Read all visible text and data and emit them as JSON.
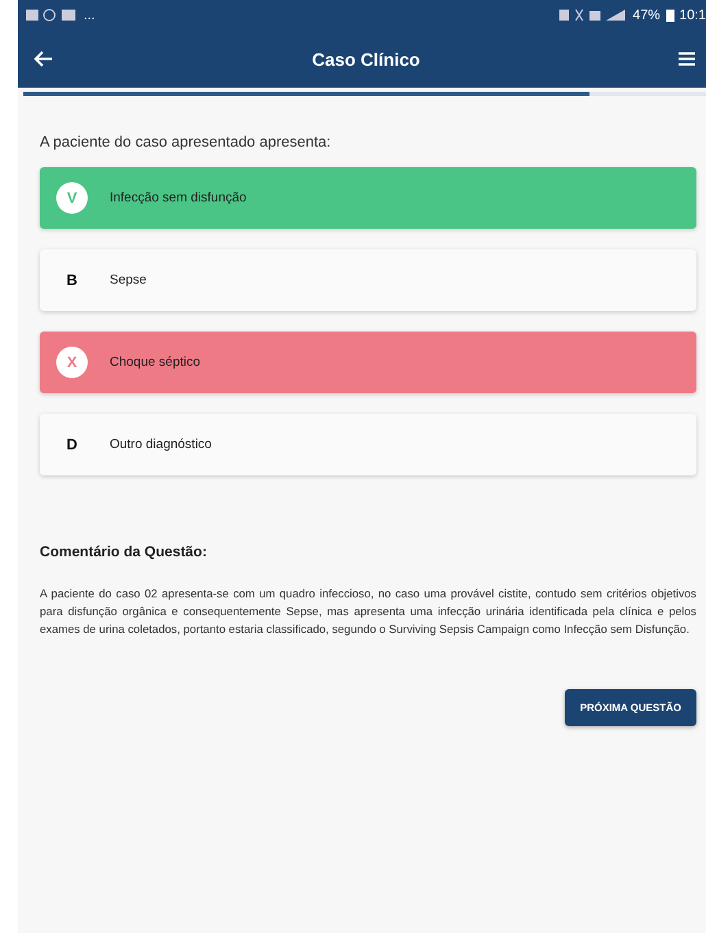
{
  "status_bar": {
    "more": "...",
    "battery": "47%",
    "time": "10:1"
  },
  "header": {
    "title": "Caso Clínico"
  },
  "progress": {
    "level": 0.83
  },
  "question": "A paciente do caso apresentado apresenta:",
  "options": [
    {
      "letter": "V",
      "text": "Infecção sem disfunção",
      "kind": "correct"
    },
    {
      "letter": "B",
      "text": "Sepse",
      "kind": "neutral"
    },
    {
      "letter": "X",
      "text": "Choque séptico",
      "kind": "wrong"
    },
    {
      "letter": "D",
      "text": "Outro diagnóstico",
      "kind": "neutral"
    }
  ],
  "comment": {
    "title": "Comentário da Questão:",
    "text": "A paciente do caso 02 apresenta-se com um quadro infeccioso, no caso uma provável cistite, contudo sem critérios objetivos para disfunção orgânica e consequentemente Sepse, mas apresenta uma infecção urinária identificada pela clínica e pelos exames de urina coletados, portanto estaria classificado, segundo o Surviving Sepsis Campaign como Infecção sem Disfunção."
  },
  "next_button": "PRÓXIMA QUESTÃO"
}
